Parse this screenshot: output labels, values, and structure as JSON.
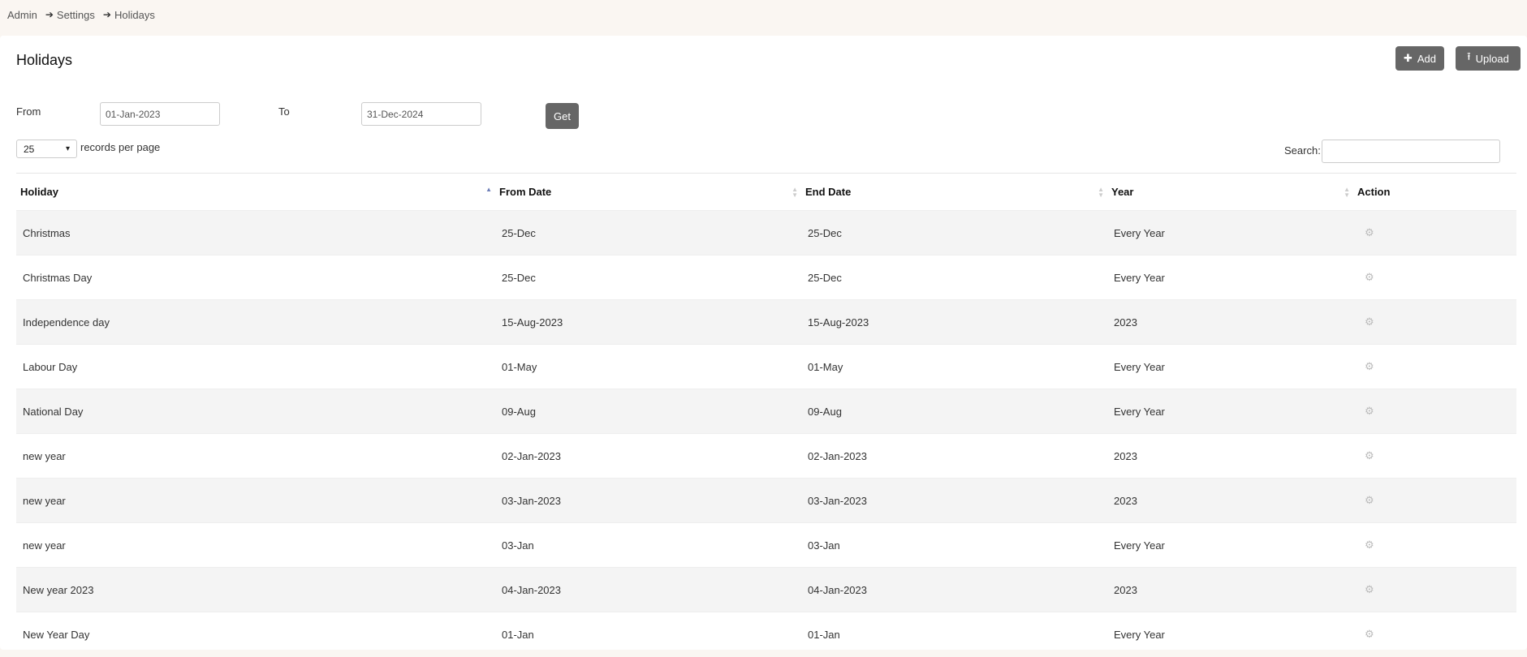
{
  "breadcrumb": {
    "items": [
      "Admin",
      "Settings",
      "Holidays"
    ]
  },
  "page": {
    "title": "Holidays"
  },
  "buttons": {
    "add": "Add",
    "upload": "Upload",
    "get": "Get"
  },
  "filters": {
    "from_label": "From",
    "from_value": "01-Jan-2023",
    "to_label": "To",
    "to_value": "31-Dec-2024"
  },
  "pagination": {
    "per_page": "25",
    "per_page_label": "records per page"
  },
  "search": {
    "label": "Search:",
    "value": ""
  },
  "table": {
    "headers": [
      "Holiday",
      "From Date",
      "End Date",
      "Year",
      "Action"
    ],
    "rows": [
      [
        "Christmas",
        "25-Dec",
        "25-Dec",
        "Every Year"
      ],
      [
        "Christmas Day",
        "25-Dec",
        "25-Dec",
        "Every Year"
      ],
      [
        "Independence day",
        "15-Aug-2023",
        "15-Aug-2023",
        "2023"
      ],
      [
        "Labour Day",
        "01-May",
        "01-May",
        "Every Year"
      ],
      [
        "National Day",
        "09-Aug",
        "09-Aug",
        "Every Year"
      ],
      [
        "new year",
        "02-Jan-2023",
        "02-Jan-2023",
        "2023"
      ],
      [
        "new year",
        "03-Jan-2023",
        "03-Jan-2023",
        "2023"
      ],
      [
        "new year",
        "03-Jan",
        "03-Jan",
        "Every Year"
      ],
      [
        "New year 2023",
        "04-Jan-2023",
        "04-Jan-2023",
        "2023"
      ],
      [
        "New Year Day",
        "01-Jan",
        "01-Jan",
        "Every Year"
      ]
    ]
  },
  "icons": {
    "add": "plus-icon",
    "upload": "upload-icon",
    "action": "gear-icon",
    "breadcrumb": "arrow-right-icon"
  }
}
